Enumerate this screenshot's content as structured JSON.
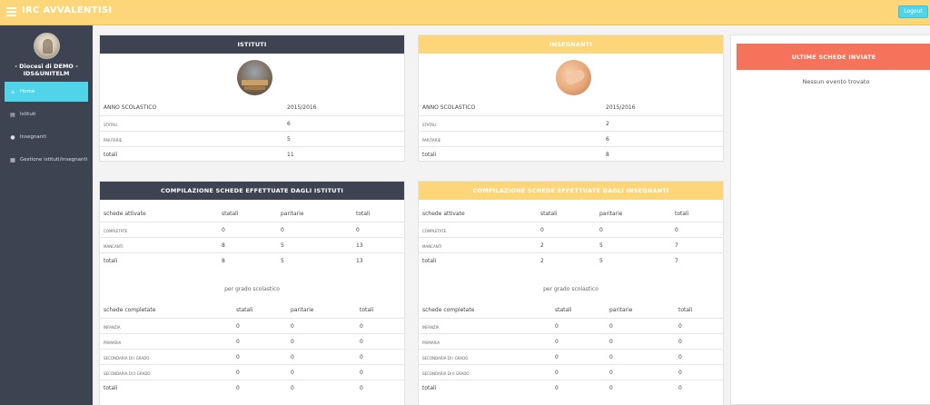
{
  "app": {
    "title": "IRC AVVALENTISI",
    "logout_label": "Logout"
  },
  "sidebar": {
    "profile_line1": "- Diocesi di DEMO -",
    "profile_line2": "IDS&UNITELM",
    "items": [
      {
        "label": "Home",
        "icon": "home-icon"
      },
      {
        "label": "Istituti",
        "icon": "book-icon"
      },
      {
        "label": "Insegnanti",
        "icon": "user-icon"
      },
      {
        "label": "Gestione istituti/insegnanti",
        "icon": "table-icon"
      }
    ]
  },
  "istituti": {
    "title": "ISTITUTI",
    "year_label": "ANNO SCOLASTICO",
    "year_value": "2015/2016",
    "rows": [
      {
        "label": "STATALI",
        "value": "6"
      },
      {
        "label": "PARITARIE",
        "value": "5"
      },
      {
        "label": "totali",
        "value": "11"
      }
    ]
  },
  "insegnanti": {
    "title": "INSEGNANTI",
    "year_label": "ANNO SCOLASTICO",
    "year_value": "2015/2016",
    "rows": [
      {
        "label": "STATALI",
        "value": "2"
      },
      {
        "label": "PARITARIE",
        "value": "6"
      },
      {
        "label": "totali",
        "value": "8"
      }
    ]
  },
  "ultime": {
    "title": "ULTIME SCHEDE INVIATE",
    "empty_text": "Nessun evento trovato"
  },
  "comp_istituti": {
    "title": "COMPILAZIONE SCHEDE EFFETTUATE DAGLI ISTITUTI",
    "head": [
      "schede attivate",
      "statali",
      "paritarie",
      "totali"
    ],
    "rows": [
      [
        "COMPLETATE",
        "0",
        "0",
        "0"
      ],
      [
        "MANCANTI",
        "8",
        "5",
        "13"
      ],
      [
        "totali",
        "8",
        "5",
        "13"
      ]
    ],
    "grado_label": "per grado scolastico",
    "head2": [
      "schede completate",
      "statali",
      "paritarie",
      "totali"
    ],
    "rows2": [
      [
        "INFANZIA",
        "0",
        "0",
        "0"
      ],
      [
        "PRIMARIA",
        "0",
        "0",
        "0"
      ],
      [
        "SECONDARIA DI I GRADO",
        "0",
        "0",
        "0"
      ],
      [
        "SECONDARIA DI II GRADO",
        "0",
        "0",
        "0"
      ],
      [
        "totali",
        "0",
        "0",
        "0"
      ]
    ]
  },
  "comp_insegnanti": {
    "title": "COMPILAZIONE SCHEDE EFFETTUATE DAGLI INSEGNANTI",
    "head": [
      "schede attivate",
      "statali",
      "paritarie",
      "totali"
    ],
    "rows": [
      [
        "COMPLETATE",
        "0",
        "0",
        "0"
      ],
      [
        "MANCANTI",
        "2",
        "5",
        "7"
      ],
      [
        "totali",
        "2",
        "5",
        "7"
      ]
    ],
    "grado_label": "per grado scolastico",
    "head2": [
      "schede completate",
      "statali",
      "paritarie",
      "totali"
    ],
    "rows2": [
      [
        "INFANZIA",
        "0",
        "0",
        "0"
      ],
      [
        "PRIMARIA",
        "0",
        "0",
        "0"
      ],
      [
        "SECONDARIA DI I GRADO",
        "0",
        "0",
        "0"
      ],
      [
        "SECONDARIA DI II GRADO",
        "0",
        "0",
        "0"
      ],
      [
        "totali",
        "0",
        "0",
        "0"
      ]
    ]
  }
}
